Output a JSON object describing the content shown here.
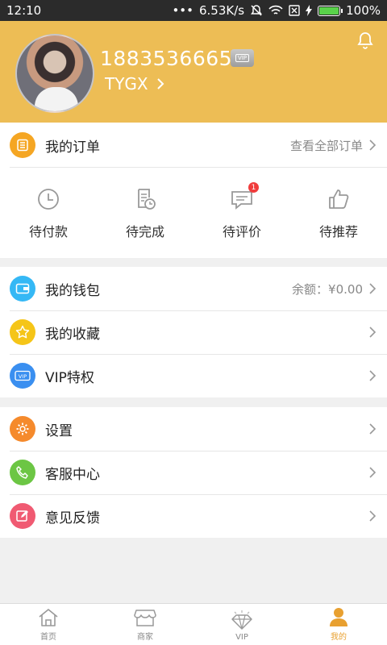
{
  "status_bar": {
    "time": "12:10",
    "network_speed": "6.53K/s",
    "battery_percent": "100%",
    "battery_level": 1.0
  },
  "profile": {
    "phone": "18835366659",
    "vip_card_label": "VIP",
    "nickname": "TYGX"
  },
  "orders": {
    "title": "我的订单",
    "view_all": "查看全部订单",
    "items": [
      {
        "label": "待付款",
        "icon": "clock-icon"
      },
      {
        "label": "待完成",
        "icon": "document-clock-icon"
      },
      {
        "label": "待评价",
        "icon": "comment-icon",
        "badge": "1"
      },
      {
        "label": "待推荐",
        "icon": "thumbs-up-icon"
      }
    ]
  },
  "menu_group1": [
    {
      "label": "我的钱包",
      "aside": "余额：¥0.00",
      "icon": "wallet-icon",
      "color": "#35b8f5"
    },
    {
      "label": "我的收藏",
      "aside": "",
      "icon": "star-icon",
      "color": "#f5c518"
    },
    {
      "label": "VIP特权",
      "aside": "",
      "icon": "vip-icon",
      "color": "#3a8ff0"
    }
  ],
  "menu_group2": [
    {
      "label": "设置",
      "icon": "gear-icon",
      "color": "#f58a2c"
    },
    {
      "label": "客服中心",
      "icon": "phone-icon",
      "color": "#6cc644"
    },
    {
      "label": "意见反馈",
      "icon": "edit-icon",
      "color": "#f05a72"
    }
  ],
  "tabbar": {
    "items": [
      {
        "label": "首页",
        "icon": "home-icon"
      },
      {
        "label": "商家",
        "icon": "store-icon"
      },
      {
        "label": "VIP",
        "icon": "diamond-icon"
      },
      {
        "label": "我的",
        "icon": "user-icon",
        "active": true
      }
    ]
  },
  "colors": {
    "header": "#edbd55",
    "orders_icon": "#f5a623",
    "tab_active": "#e8a030"
  }
}
